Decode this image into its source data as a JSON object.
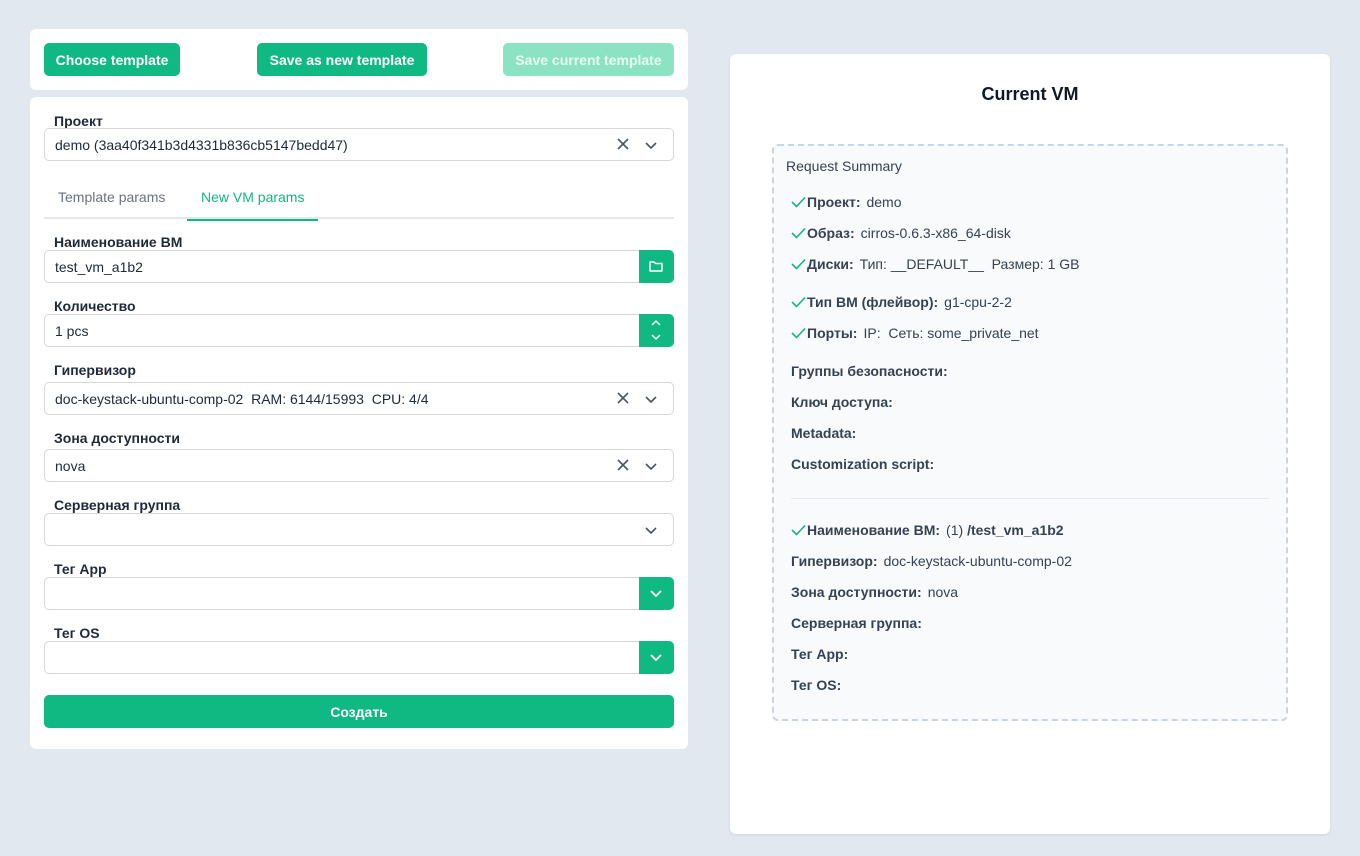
{
  "toolbar": {
    "choose_template": "Choose template",
    "save_as_new": "Save as new template",
    "save_current": "Save current template"
  },
  "form": {
    "project": {
      "label": "Проект",
      "value": "demo (3aa40f341b3d4331b836cb5147bedd47)"
    },
    "tabs": [
      {
        "label": "Template params",
        "active": false
      },
      {
        "label": "New VM params",
        "active": true
      }
    ],
    "vm_name": {
      "label": "Наименование ВМ",
      "value": "test_vm_a1b2"
    },
    "quantity": {
      "label": "Количество",
      "value": "1 pcs"
    },
    "hypervisor": {
      "label": "Гипервизор",
      "value": "doc-keystack-ubuntu-comp-02  RAM: 6144/15993  CPU: 4/4"
    },
    "zone": {
      "label": "Зона доступности",
      "value": "nova"
    },
    "server_group": {
      "label": "Серверная группа",
      "value": ""
    },
    "tag_app": {
      "label": "Тег App",
      "value": ""
    },
    "tag_os": {
      "label": "Тег OS",
      "value": ""
    },
    "create_label": "Создать"
  },
  "vm": {
    "title": "Current VM",
    "summary_title": "Request Summary",
    "rows": {
      "project": {
        "key": "Проект:",
        "value": "demo"
      },
      "image": {
        "key": "Образ:",
        "value": "cirros-0.6.3-x86_64-disk"
      },
      "disks": {
        "key": "Диски:",
        "value": "Тип: __DEFAULT__  Размер: 1 GB"
      },
      "flavor": {
        "key": "Тип ВМ (флейвор):",
        "value": "g1-cpu-2-2"
      },
      "ports": {
        "key": "Порты:",
        "value": "IP:  Сеть: some_private_net"
      },
      "security_groups": {
        "key": "Группы безопасности:",
        "value": ""
      },
      "access_key": {
        "key": "Ключ доступа:",
        "value": ""
      },
      "metadata": {
        "key": "Metadata:",
        "value": ""
      },
      "custom_script": {
        "key": "Customization script:",
        "value": ""
      },
      "vm_name": {
        "key": "Наименование ВМ:",
        "count": "(1)",
        "value": "/test_vm_a1b2"
      },
      "hypervisor": {
        "key": "Гипервизор:",
        "value": "doc-keystack-ubuntu-comp-02"
      },
      "zone": {
        "key": "Зона доступности:",
        "value": "nova"
      },
      "server_group": {
        "key": "Серверная группа:",
        "value": ""
      },
      "tag_app": {
        "key": "Тег App:",
        "value": ""
      },
      "tag_os": {
        "key": "Тег OS:",
        "value": ""
      }
    }
  },
  "colors": {
    "accent": "#10b981",
    "accent_disabled": "#8be3c4",
    "background": "#e2e8f0"
  }
}
